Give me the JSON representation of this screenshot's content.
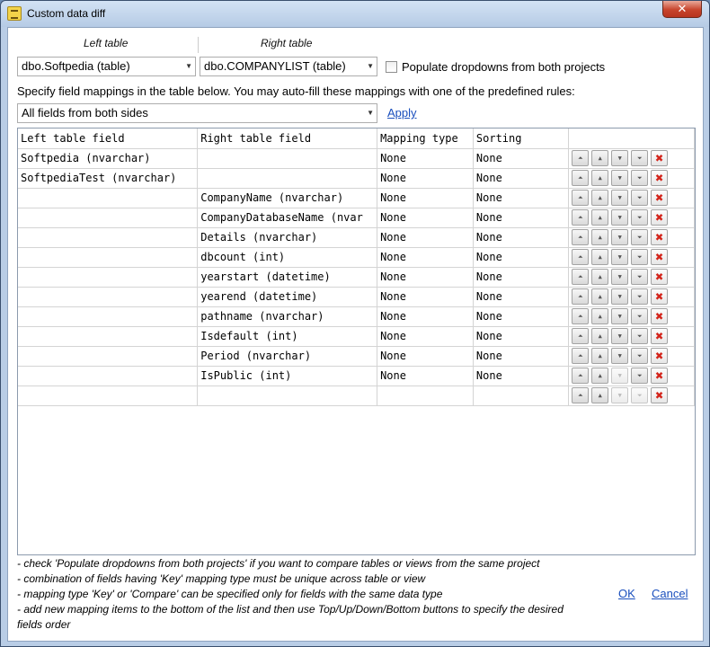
{
  "window": {
    "title": "Custom data diff",
    "close_label": "✕"
  },
  "left_table": {
    "header": "Left table",
    "value": "dbo.Softpedia (table)"
  },
  "right_table": {
    "header": "Right table",
    "value": "dbo.COMPANYLIST (table)"
  },
  "populate_checkbox": {
    "label": "Populate dropdowns from both projects",
    "checked": false
  },
  "instructions": "Specify field mappings in the table below. You may auto-fill these mappings with one of the predefined rules:",
  "rule_combo": {
    "value": "All fields from both sides"
  },
  "apply_label": "Apply",
  "grid": {
    "columns": [
      "Left table field",
      "Right table field",
      "Mapping type",
      "Sorting"
    ],
    "rows": [
      [
        "Softpedia (nvarchar)",
        "",
        "None",
        "None"
      ],
      [
        "SoftpediaTest (nvarchar)",
        "",
        "None",
        "None"
      ],
      [
        "",
        "CompanyName (nvarchar)",
        "None",
        "None"
      ],
      [
        "",
        "CompanyDatabaseName (nvar",
        "None",
        "None"
      ],
      [
        "",
        "Details (nvarchar)",
        "None",
        "None"
      ],
      [
        "",
        "dbcount (int)",
        "None",
        "None"
      ],
      [
        "",
        "yearstart (datetime)",
        "None",
        "None"
      ],
      [
        "",
        "yearend (datetime)",
        "None",
        "None"
      ],
      [
        "",
        "pathname (nvarchar)",
        "None",
        "None"
      ],
      [
        "",
        "Isdefault (int)",
        "None",
        "None"
      ],
      [
        "",
        "Period (nvarchar)",
        "None",
        "None"
      ],
      [
        "",
        "IsPublic (int)",
        "None",
        "None"
      ],
      [
        "",
        "",
        "",
        ""
      ]
    ],
    "row_buttons": [
      {
        "name": "move-top",
        "icon": "top-icon",
        "glyph": "⏶"
      },
      {
        "name": "move-up",
        "icon": "up-icon",
        "glyph": "▲"
      },
      {
        "name": "move-down",
        "icon": "down-icon",
        "glyph": "▼"
      },
      {
        "name": "move-bottom",
        "icon": "bottom-icon",
        "glyph": "⏷"
      },
      {
        "name": "delete",
        "icon": "delete-icon",
        "glyph": "✖"
      }
    ]
  },
  "notes": [
    "- check 'Populate dropdowns from both projects' if you want to compare tables or views from the same project",
    "- combination of fields having 'Key' mapping type must be unique across table or view",
    "- mapping type 'Key' or 'Compare' can be specified only for fields with the same data type",
    "- add new mapping items to the bottom of the list and then use Top/Up/Down/Bottom buttons to specify the desired",
    "fields order"
  ],
  "ok_label": "OK",
  "cancel_label": "Cancel"
}
